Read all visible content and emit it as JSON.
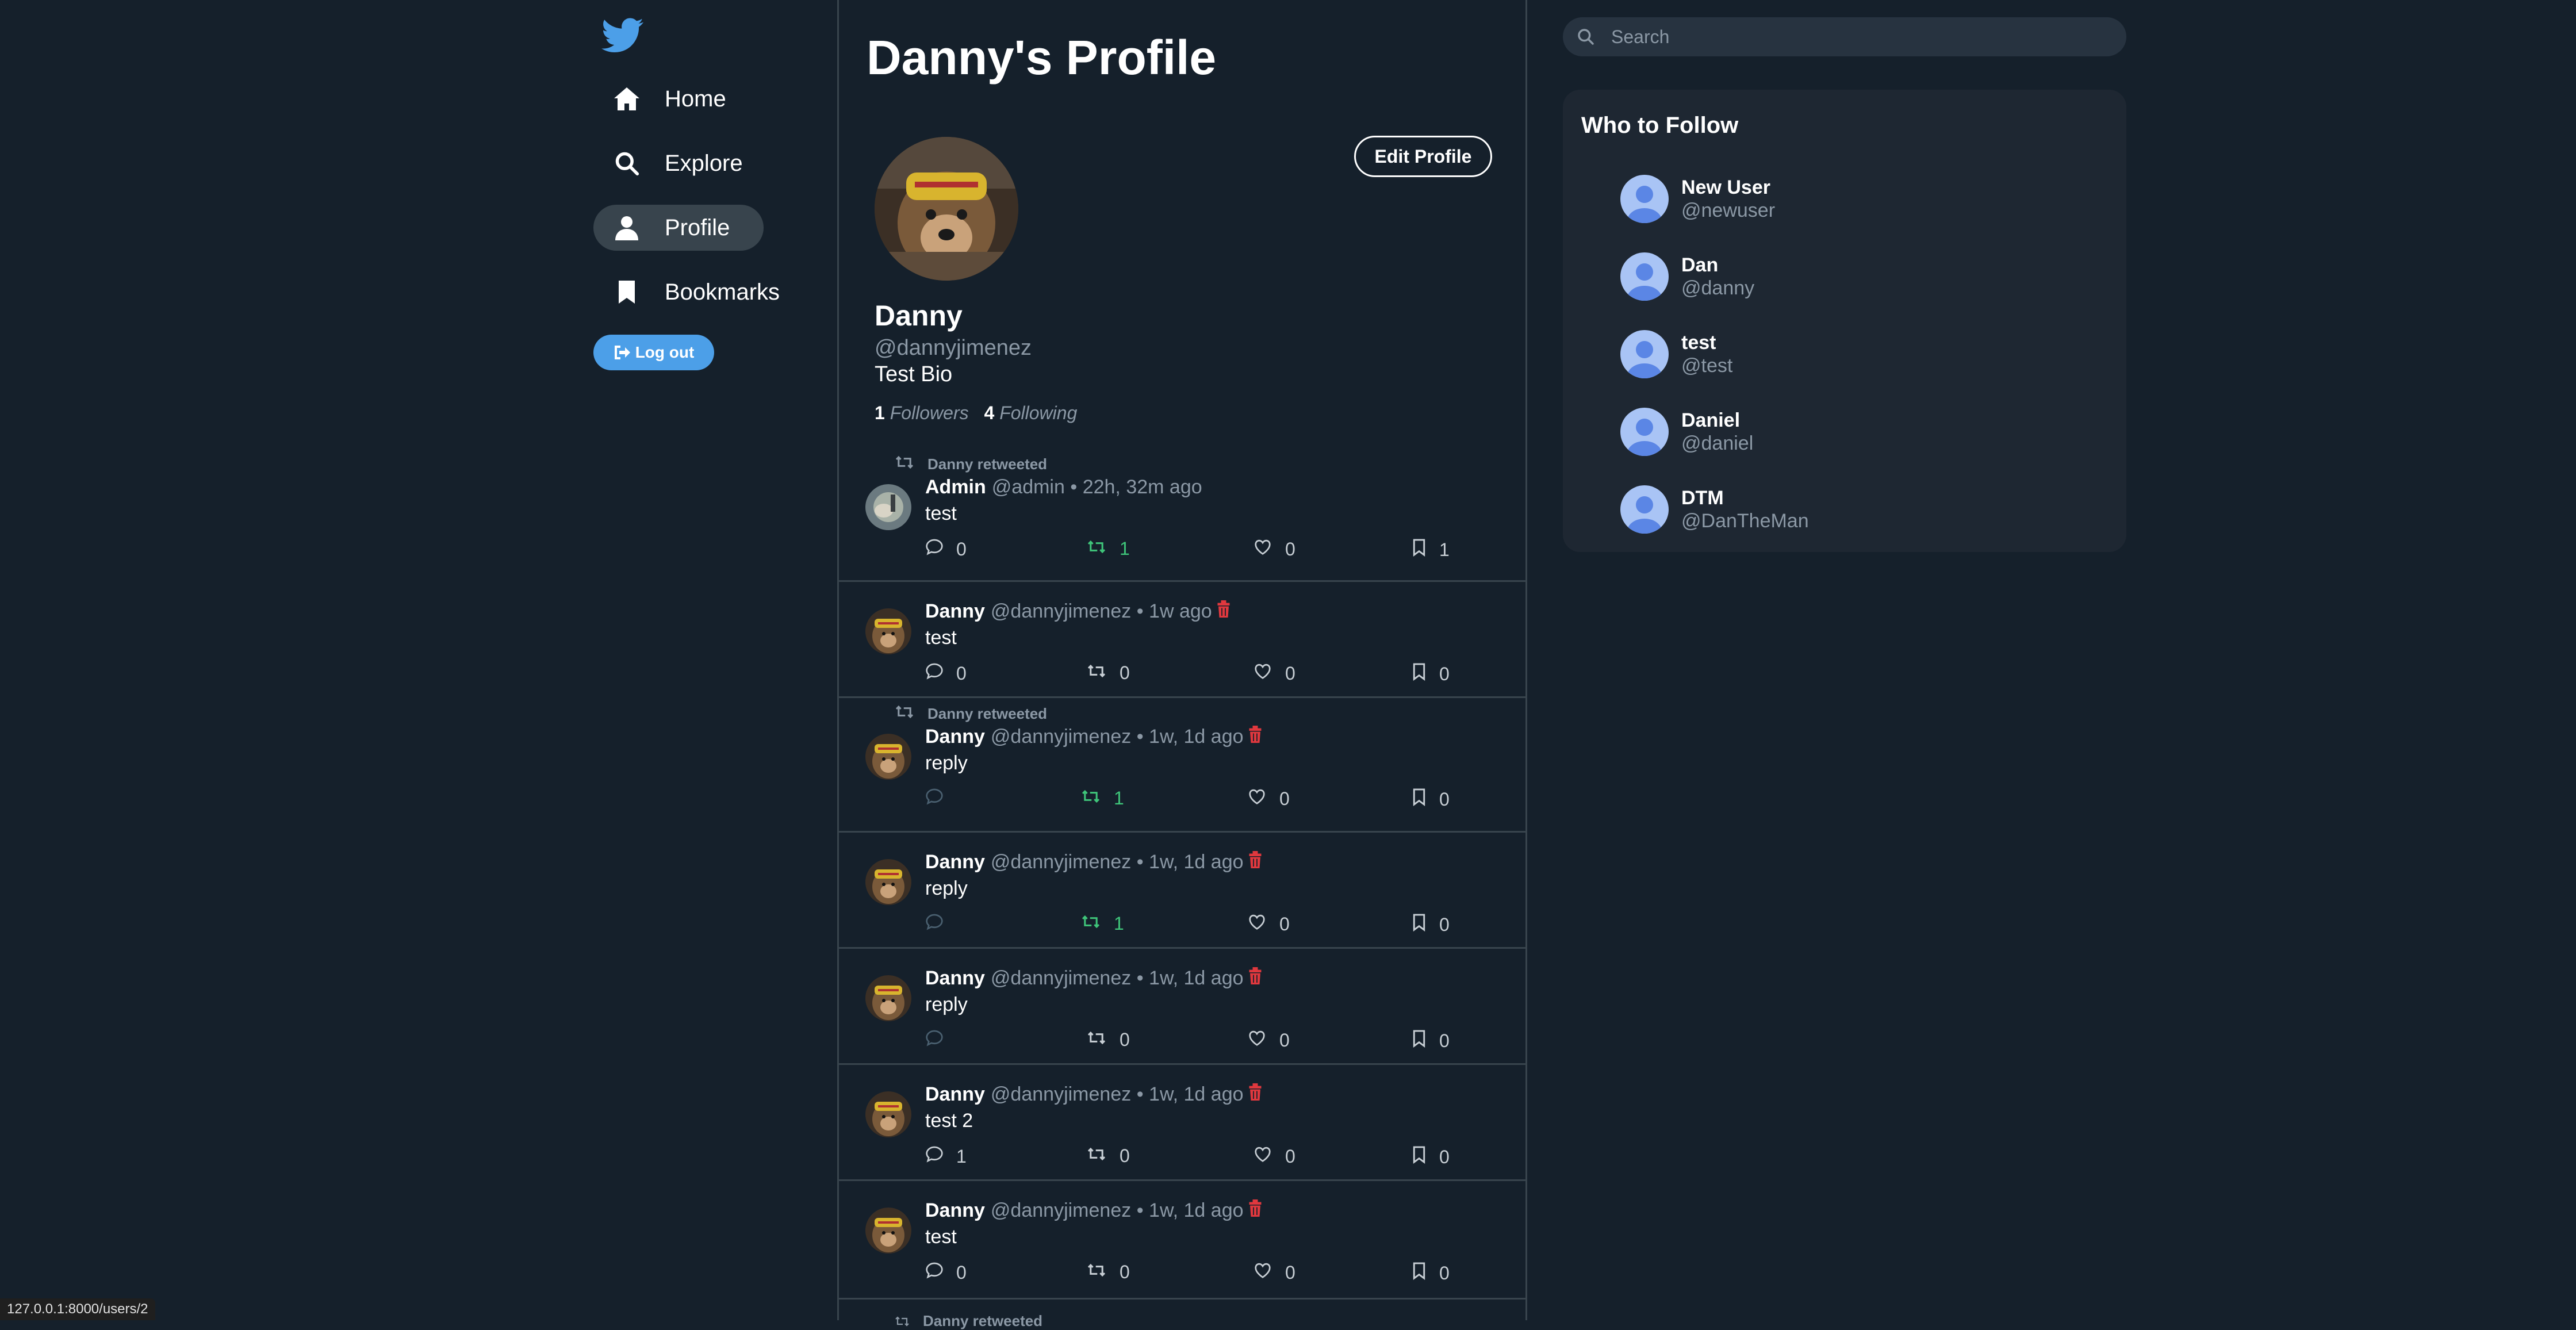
{
  "colors": {
    "background": "#15202b",
    "accent": "#4c9fe8",
    "retweet_active": "#3fc57a",
    "delete": "#e0383e"
  },
  "nav": {
    "logo": "twitter-bird-icon",
    "items": [
      {
        "label": "Home",
        "icon": "home-icon"
      },
      {
        "label": "Explore",
        "icon": "search-icon"
      },
      {
        "label": "Profile",
        "icon": "user-icon",
        "active": true
      },
      {
        "label": "Bookmarks",
        "icon": "bookmark-icon"
      }
    ],
    "logout_label": "Log out"
  },
  "profile": {
    "page_title": "Danny's Profile",
    "edit_label": "Edit Profile",
    "name": "Danny",
    "handle": "@dannyjimenez",
    "bio": "Test Bio",
    "followers_count": "1",
    "followers_label": "Followers",
    "following_count": "4",
    "following_label": "Following"
  },
  "tweets": [
    {
      "retweeted_by": "Danny retweeted",
      "author": "Admin",
      "handle": "@admin",
      "time": "• 22h, 32m ago",
      "text": "test",
      "replies": "0",
      "retweets": "1",
      "likes": "0",
      "bookmarks": "1",
      "retweet_active": true,
      "deletable": false
    },
    {
      "retweeted_by": "",
      "author": "Danny",
      "handle": "@dannyjimenez",
      "time": "• 1w ago",
      "text": "test",
      "replies": "0",
      "retweets": "0",
      "likes": "0",
      "bookmarks": "0",
      "retweet_active": false,
      "deletable": true
    },
    {
      "retweeted_by": "Danny retweeted",
      "author": "Danny",
      "handle": "@dannyjimenez",
      "time": "• 1w, 1d ago",
      "text": "reply",
      "replies": "",
      "retweets": "1",
      "likes": "0",
      "bookmarks": "0",
      "retweet_active": true,
      "deletable": true
    },
    {
      "retweeted_by": "",
      "author": "Danny",
      "handle": "@dannyjimenez",
      "time": "• 1w, 1d ago",
      "text": "reply",
      "replies": "",
      "retweets": "1",
      "likes": "0",
      "bookmarks": "0",
      "retweet_active": true,
      "deletable": true
    },
    {
      "retweeted_by": "",
      "author": "Danny",
      "handle": "@dannyjimenez",
      "time": "• 1w, 1d ago",
      "text": "reply",
      "replies": "",
      "retweets": "0",
      "likes": "0",
      "bookmarks": "0",
      "retweet_active": false,
      "deletable": true
    },
    {
      "retweeted_by": "",
      "author": "Danny",
      "handle": "@dannyjimenez",
      "time": "• 1w, 1d ago",
      "text": "test 2",
      "replies": "1",
      "retweets": "0",
      "likes": "0",
      "bookmarks": "0",
      "retweet_active": false,
      "deletable": true
    },
    {
      "retweeted_by": "",
      "author": "Danny",
      "handle": "@dannyjimenez",
      "time": "• 1w, 1d ago",
      "text": "test",
      "replies": "0",
      "retweets": "0",
      "likes": "0",
      "bookmarks": "0",
      "retweet_active": false,
      "deletable": true
    }
  ],
  "tweets_cutoff_label": "Danny retweeted",
  "search": {
    "placeholder": "Search"
  },
  "who_to_follow": {
    "title": "Who to Follow",
    "users": [
      {
        "name": "New User",
        "handle": "@newuser"
      },
      {
        "name": "Dan",
        "handle": "@danny"
      },
      {
        "name": "test",
        "handle": "@test"
      },
      {
        "name": "Daniel",
        "handle": "@daniel"
      },
      {
        "name": "DTM",
        "handle": "@DanTheMan"
      }
    ]
  },
  "status_bar": {
    "url": "127.0.0.1:8000/users/2"
  }
}
